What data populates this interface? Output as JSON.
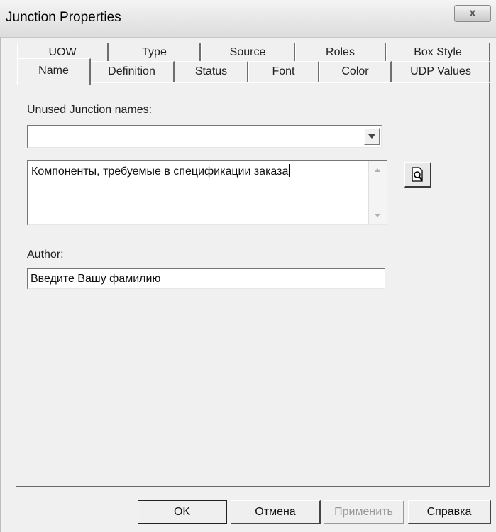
{
  "window": {
    "title": "Junction Properties",
    "close_label": "x"
  },
  "tabs": {
    "row1": [
      {
        "label": "UOW"
      },
      {
        "label": "Type"
      },
      {
        "label": "Source"
      },
      {
        "label": "Roles"
      },
      {
        "label": "Box Style"
      }
    ],
    "row2": [
      {
        "label": "Name",
        "active": true
      },
      {
        "label": "Definition"
      },
      {
        "label": "Status"
      },
      {
        "label": "Font"
      },
      {
        "label": "Color"
      },
      {
        "label": "UDP Values"
      }
    ]
  },
  "name_tab": {
    "unused_names_label": "Unused Junction names:",
    "unused_names_value": "",
    "name_text": "Компоненты, требуемые в спецификации заказа",
    "author_label": "Author:",
    "author_value": "Введите Вашу фамилию"
  },
  "buttons": {
    "ok": "OK",
    "cancel": "Отмена",
    "apply": "Применить",
    "help": "Справка"
  },
  "icons": {
    "lookup": "magnifier-document-icon",
    "dropdown": "chevron-down-icon",
    "close": "close-icon"
  }
}
